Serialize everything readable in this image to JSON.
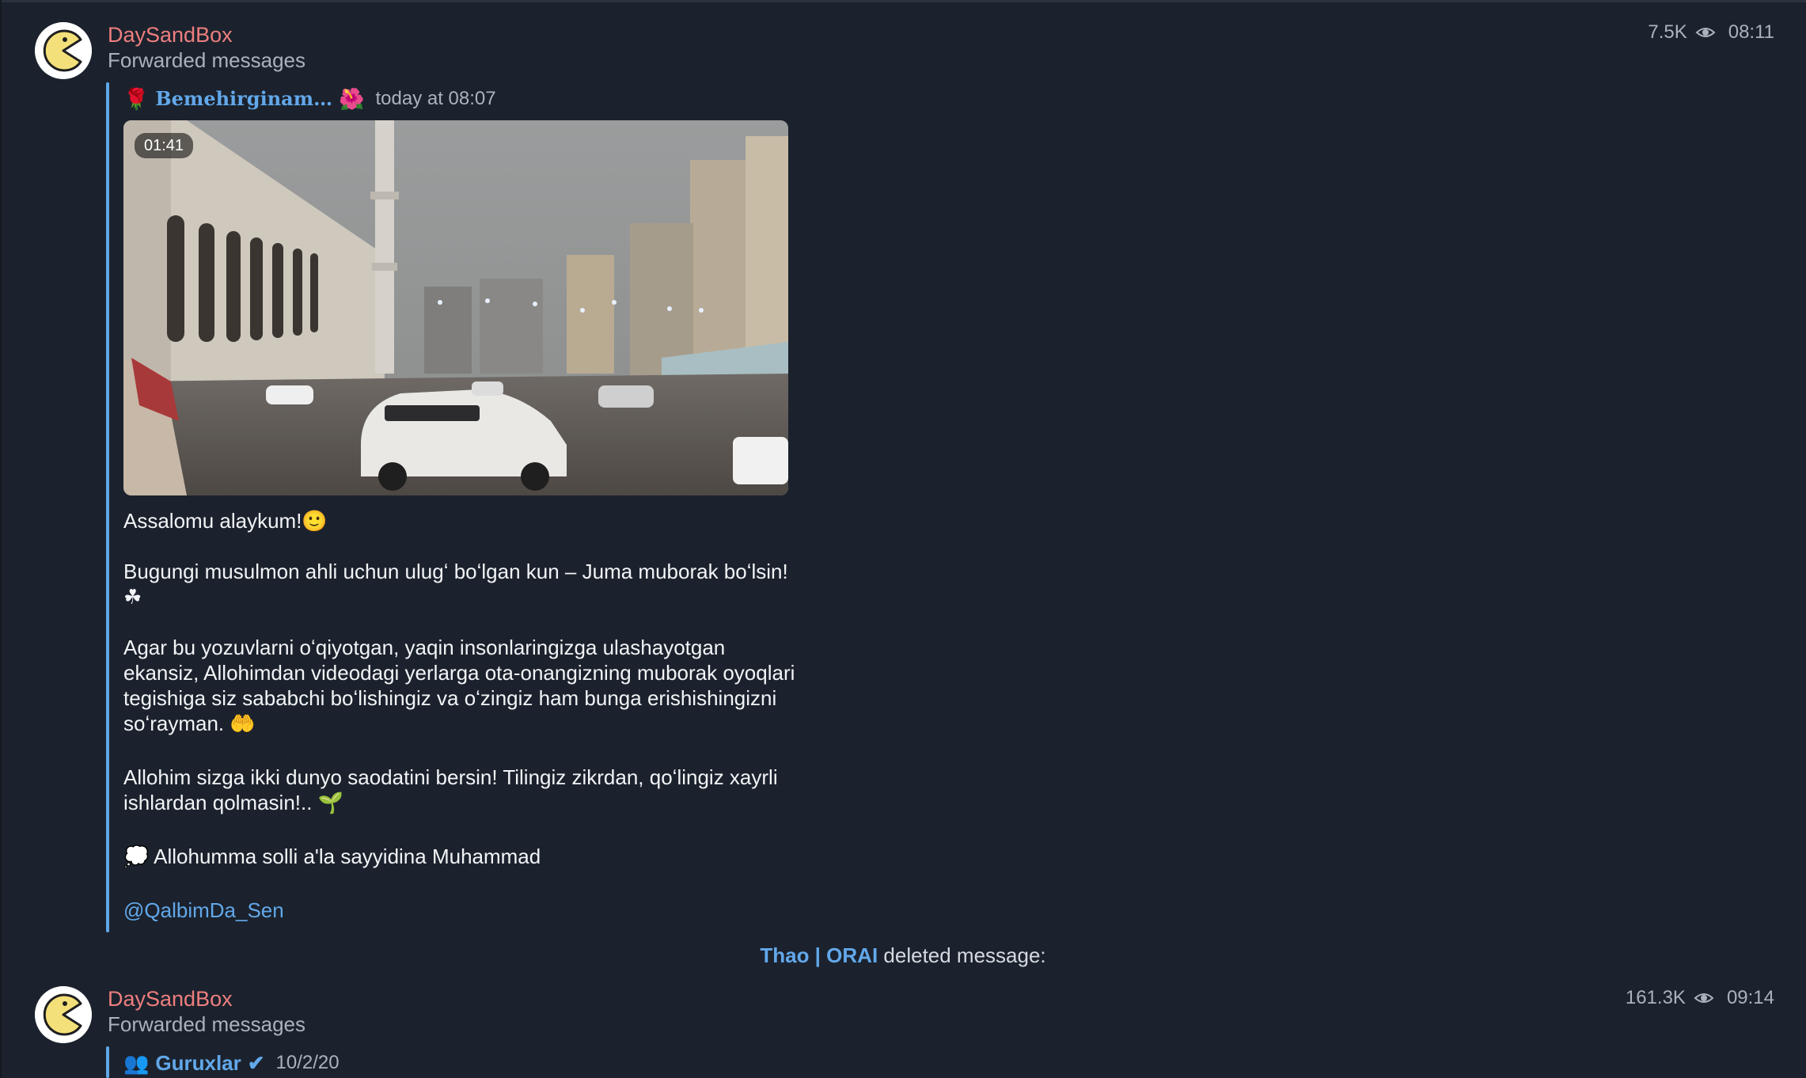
{
  "messages": [
    {
      "author": "DaySandBox",
      "subtitle": "Forwarded messages",
      "views": "7.5K",
      "time": "08:11",
      "forward": {
        "prefix_emoji": "🌹",
        "from": "Bemehirginam…",
        "suffix_emoji": "🌺",
        "date": "today at 08:07"
      },
      "video_duration": "01:41",
      "paragraphs": [
        "Assalomu alaykum!🙂",
        "Bugungi musulmon ahli uchun ulugʻ boʻlgan kun – Juma muborak boʻlsin! ☘",
        "Agar bu yozuvlarni oʻqiyotgan, yaqin insonlaringizga ulashayotgan ekansiz, Allohimdan videodagi yerlarga ota-onangizning muborak oyoqlari tegishiga siz sababchi boʻlishingiz va oʻzingiz ham bunga erishishingizni soʻrayman. 🤲",
        "Allohim sizga ikki dunyo saodatini bersin! Tilingiz zikrdan, qoʻlingiz xayrli ishlardan qolmasin!.. 🌱",
        "💭 Allohumma solli a'la sayyidina Muhammad"
      ],
      "signature_link": "@QalbimDa_Sen"
    },
    {
      "author": "DaySandBox",
      "subtitle": "Forwarded messages",
      "views": "161.3K",
      "time": "09:14",
      "forward": {
        "prefix_emoji": "👥",
        "from": "Guruxlar",
        "verified_mark": "✔",
        "date": "10/2/20"
      }
    }
  ],
  "service_message": {
    "actor": "Thao | ORAI",
    "text": "deleted message:"
  },
  "colors": {
    "background": "#1b222d",
    "author": "#ee7f7f",
    "accent_link": "#62a8ea",
    "muted": "#aab2bc"
  },
  "icons": [
    "pacman-avatar-icon",
    "eye-icon"
  ]
}
